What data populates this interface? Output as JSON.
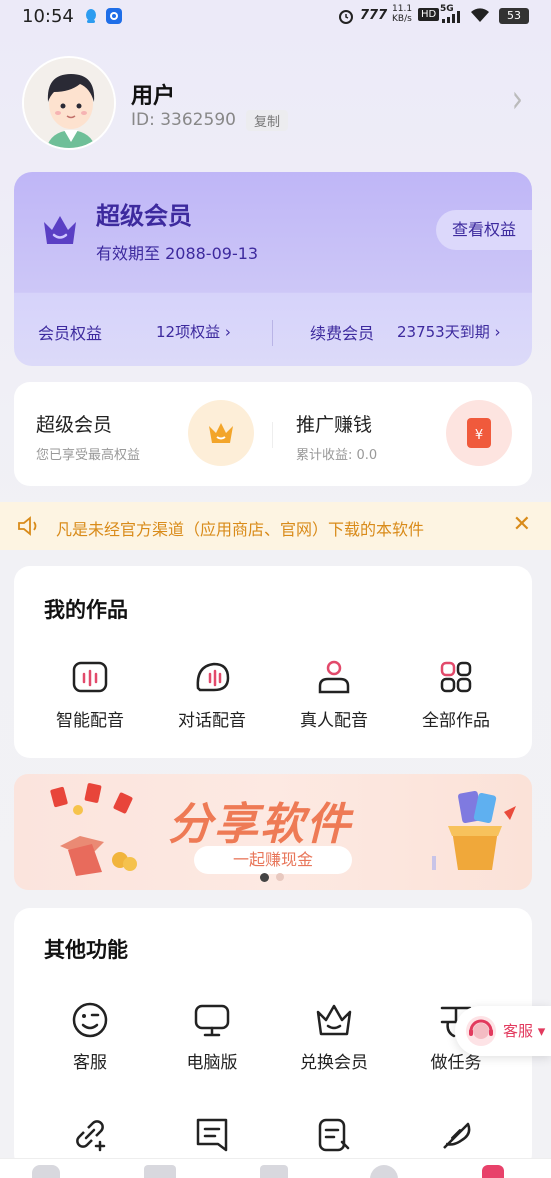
{
  "status_bar": {
    "time": "10:54",
    "network_speed": "11.1\nKB/s",
    "hd": "HD",
    "signal": "5G",
    "battery": "53"
  },
  "profile": {
    "name": "用户",
    "id_text": "ID: 3362590",
    "copy_label": "复制"
  },
  "member_card": {
    "title": "超级会员",
    "expire_text": "有效期至 2088-09-13",
    "view_benefits": "查看权益",
    "benefits_label": "会员权益",
    "benefits_value": "12项权益 ›",
    "renew_label": "续费会员",
    "renew_value": "23753天到期 ›",
    "accent": "#3d2a9e"
  },
  "promo": {
    "left_title": "超级会员",
    "left_sub": "您已享受最高权益",
    "right_title": "推广赚钱",
    "right_sub": "累计收益: 0.0"
  },
  "notice": {
    "text": "凡是未经官方渠道（应用商店、官网）下载的本软件",
    "close": "✕",
    "color": "#d98b1a"
  },
  "my_works": {
    "title": "我的作品",
    "items": [
      {
        "label": "智能配音",
        "icon": "voice-wave-icon"
      },
      {
        "label": "对话配音",
        "icon": "chat-bubble-icon"
      },
      {
        "label": "真人配音",
        "icon": "person-icon"
      },
      {
        "label": "全部作品",
        "icon": "grid-icon"
      }
    ]
  },
  "banner": {
    "title": "分享软件",
    "subtitle": "一起赚现金"
  },
  "other_features": {
    "title": "其他功能",
    "items": [
      {
        "label": "客服",
        "icon": "smile-icon"
      },
      {
        "label": "电脑版",
        "icon": "monitor-icon"
      },
      {
        "label": "兑换会员",
        "icon": "crown-icon"
      },
      {
        "label": "做任务",
        "icon": "task-icon"
      }
    ],
    "row2_icons": [
      "link-add-icon",
      "note-icon",
      "document-edit-icon",
      "feather-icon"
    ]
  },
  "service_float": {
    "label": "客服 ▾"
  }
}
